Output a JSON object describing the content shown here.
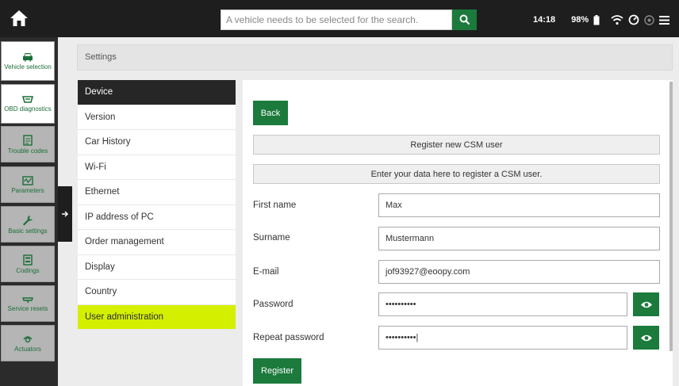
{
  "search": {
    "placeholder": "A vehicle needs to be selected for the search."
  },
  "status": {
    "time": "14:18",
    "battery": "98%"
  },
  "sidebar": {
    "items": [
      {
        "label": "Vehicle selection",
        "icon": "car-icon"
      },
      {
        "label": "OBD diagnostics",
        "icon": "obd-plug-icon"
      },
      {
        "label": "Trouble codes",
        "icon": "trouble-codes-icon"
      },
      {
        "label": "Parameters",
        "icon": "parameters-icon"
      },
      {
        "label": "Basic settings",
        "icon": "wrench-icon"
      },
      {
        "label": "Codings",
        "icon": "codings-icon"
      },
      {
        "label": "Service resets",
        "icon": "service-reset-icon"
      },
      {
        "label": "Actuators",
        "icon": "actuators-icon"
      }
    ]
  },
  "breadcrumb": "Settings",
  "menu": {
    "items": [
      "Device",
      "Version",
      "Car History",
      "Wi-Fi",
      "Ethernet",
      "IP address of PC",
      "Order management",
      "Display",
      "Country",
      "User administration"
    ],
    "active": "User administration"
  },
  "form": {
    "back_label": "Back",
    "title_bar": "Register new CSM user",
    "info_bar": "Enter your data here to register a CSM user.",
    "first_name_label": "First name",
    "first_name_value": "Max",
    "surname_label": "Surname",
    "surname_value": "Mustermann",
    "email_label": "E-mail",
    "email_value": "jof93927@eoopy.com",
    "password_label": "Password",
    "password_value": "••••••••••",
    "repeat_password_label": "Repeat password",
    "repeat_password_value": "••••••••••|",
    "register_label": "Register"
  },
  "colors": {
    "accent": "#1b7a3c",
    "highlight": "#d4f000",
    "dark": "#1e1e1e"
  }
}
